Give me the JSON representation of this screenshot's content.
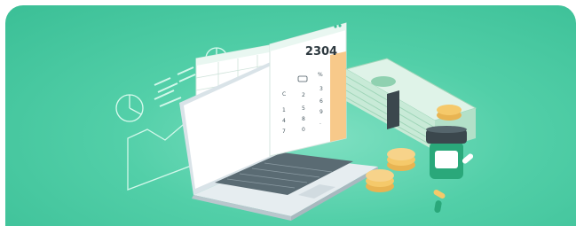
{
  "illustration": {
    "calculator": {
      "display": "2304",
      "keys": [
        "C",
        "%",
        "1",
        "2",
        "3",
        "4",
        "5",
        "6",
        "7",
        "8",
        "9",
        "0",
        "."
      ]
    },
    "colors": {
      "background": "#45c39c",
      "accent_green": "#2aa87a",
      "money_green": "#bfe6cf",
      "coin_gold": "#f5c96a",
      "keypad_orange": "#f7c98a"
    },
    "icons": [
      "pie-chart-icon",
      "laptop-icon",
      "spreadsheet-icon",
      "calculator-icon",
      "cash-stack-icon",
      "coin-stack-icon",
      "pill-bottle-icon",
      "capsule-icon"
    ]
  }
}
